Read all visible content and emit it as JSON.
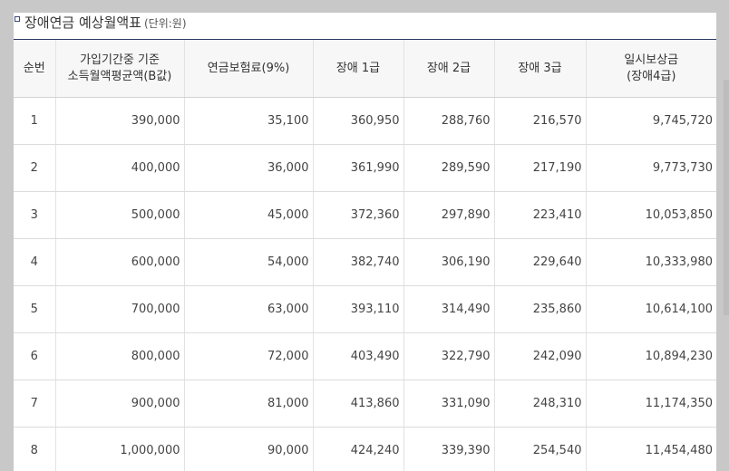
{
  "heading": {
    "title": "장애연금 예상월액표",
    "unit": "(단위:원)"
  },
  "columns": [
    {
      "lines": [
        "순번"
      ]
    },
    {
      "lines": [
        "가입기간중 기준",
        "소득월액평균액(B값)"
      ]
    },
    {
      "lines": [
        "연금보험료(9%)"
      ]
    },
    {
      "lines": [
        "장애 1급"
      ]
    },
    {
      "lines": [
        "장애 2급"
      ]
    },
    {
      "lines": [
        "장애 3급"
      ]
    },
    {
      "lines": [
        "일시보상금",
        "(장애4급)"
      ]
    }
  ],
  "rows": [
    [
      "1",
      "390,000",
      "35,100",
      "360,950",
      "288,760",
      "216,570",
      "9,745,720"
    ],
    [
      "2",
      "400,000",
      "36,000",
      "361,990",
      "289,590",
      "217,190",
      "9,773,730"
    ],
    [
      "3",
      "500,000",
      "45,000",
      "372,360",
      "297,890",
      "223,410",
      "10,053,850"
    ],
    [
      "4",
      "600,000",
      "54,000",
      "382,740",
      "306,190",
      "229,640",
      "10,333,980"
    ],
    [
      "5",
      "700,000",
      "63,000",
      "393,110",
      "314,490",
      "235,860",
      "10,614,100"
    ],
    [
      "6",
      "800,000",
      "72,000",
      "403,490",
      "322,790",
      "242,090",
      "10,894,230"
    ],
    [
      "7",
      "900,000",
      "81,000",
      "413,860",
      "331,090",
      "248,310",
      "11,174,350"
    ],
    [
      "8",
      "1,000,000",
      "90,000",
      "424,240",
      "339,390",
      "254,540",
      "11,454,480"
    ]
  ]
}
